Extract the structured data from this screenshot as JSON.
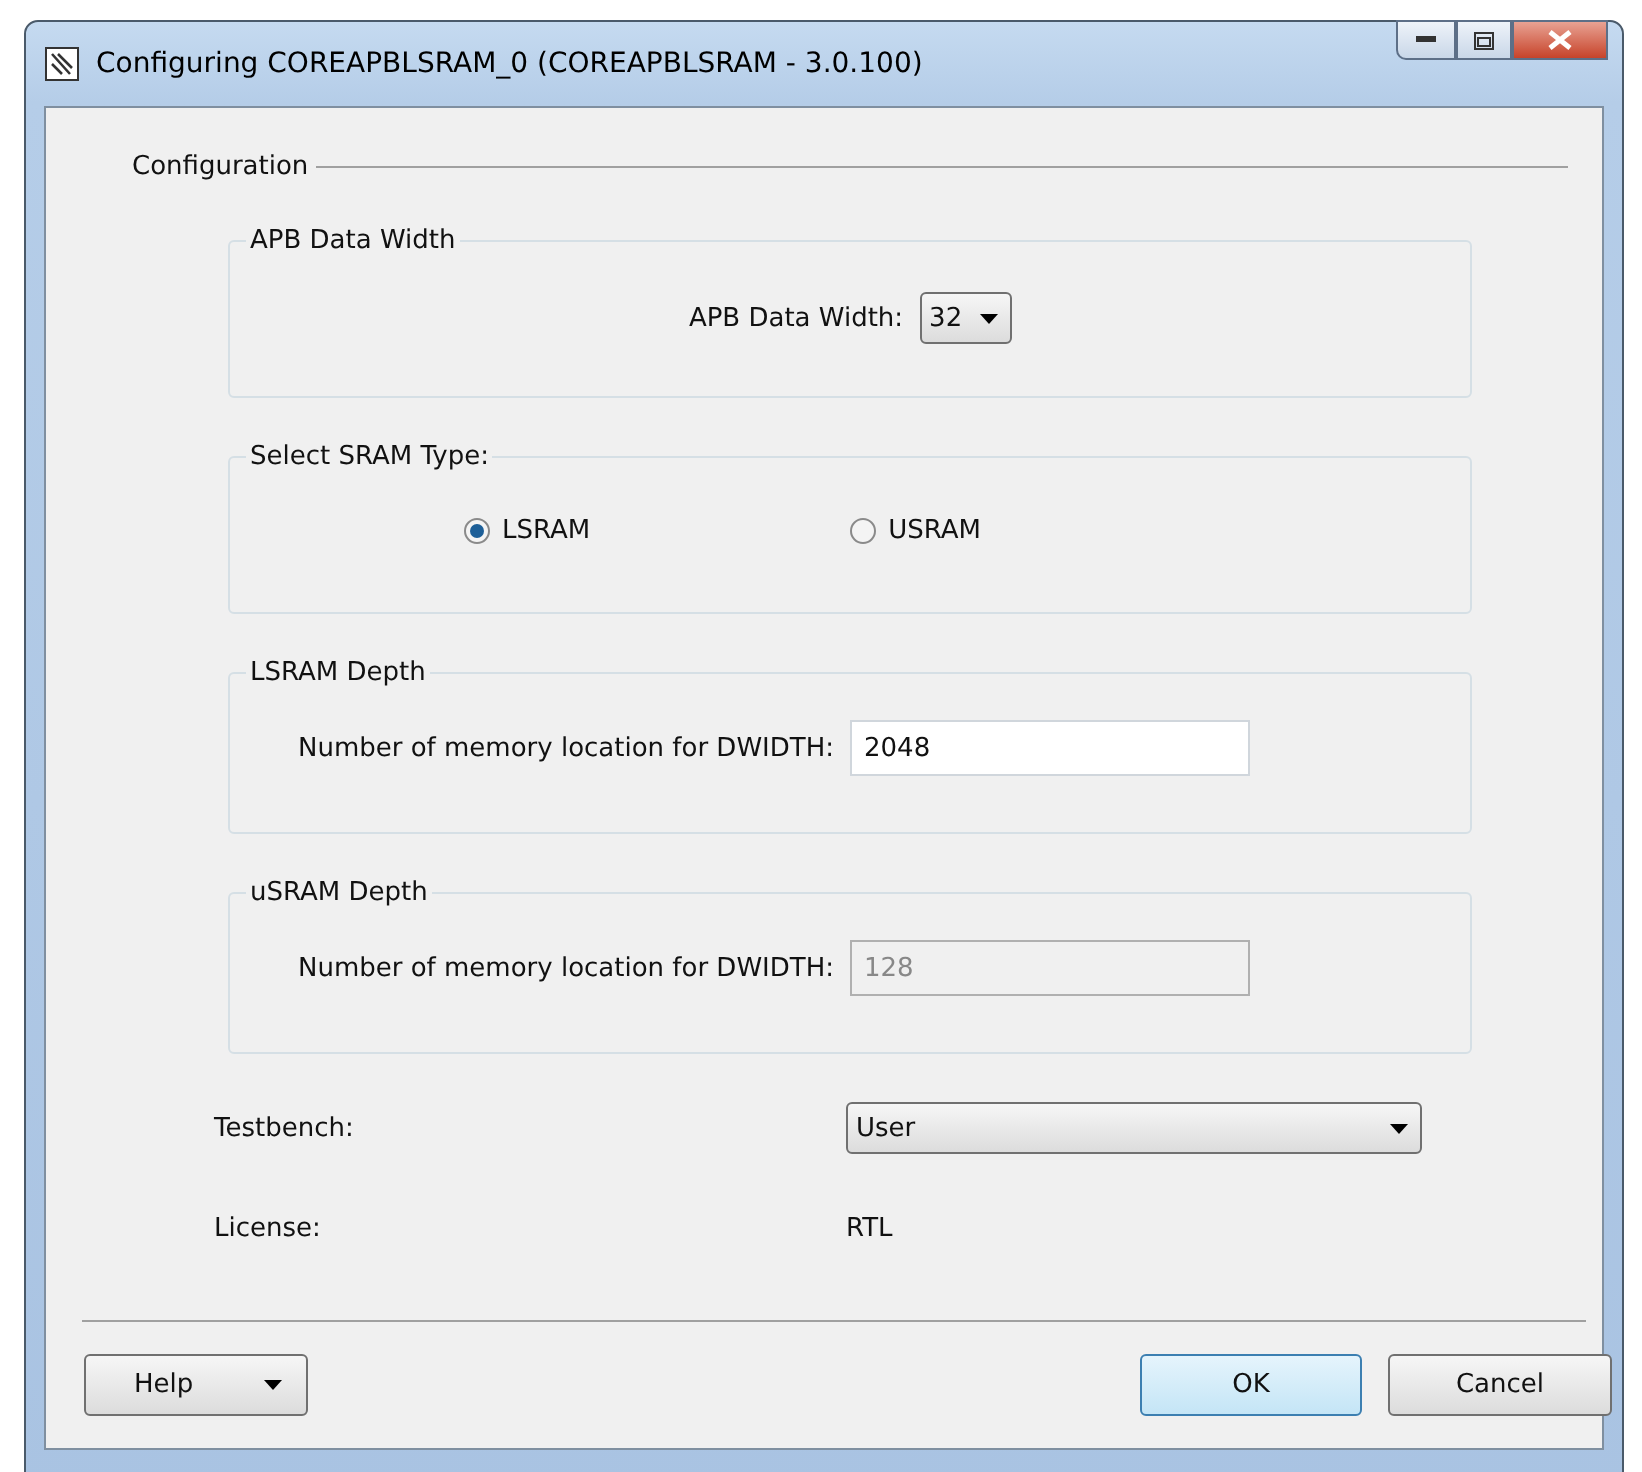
{
  "window": {
    "title": "Configuring COREAPBLSRAM_0 (COREAPBLSRAM - 3.0.100)"
  },
  "configuration": {
    "legend": "Configuration",
    "groups": [
      {
        "kind": "select",
        "legend": "APB Data Width",
        "label": "APB Data Width:",
        "value": "32"
      },
      {
        "kind": "radio",
        "legend": "Select SRAM Type:",
        "options": [
          {
            "label": "LSRAM",
            "selected": true
          },
          {
            "label": "USRAM",
            "selected": false
          }
        ]
      },
      {
        "kind": "field",
        "legend": "LSRAM Depth",
        "label": "Number of memory location for DWIDTH:",
        "value": "2048",
        "disabled": false
      },
      {
        "kind": "field",
        "legend": "uSRAM Depth",
        "label": "Number of memory location for DWIDTH:",
        "value": "128",
        "disabled": true
      }
    ],
    "testbench": {
      "label": "Testbench:",
      "value": "User"
    },
    "license": {
      "label": "License:",
      "value": "RTL"
    }
  },
  "buttons": {
    "help": "Help",
    "ok": "OK",
    "cancel": "Cancel"
  }
}
